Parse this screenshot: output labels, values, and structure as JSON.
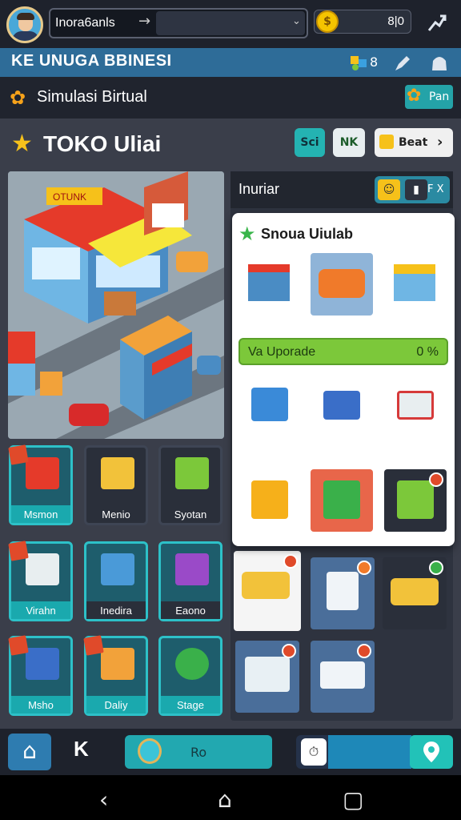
{
  "topbar": {
    "search_label": "Inora6anls",
    "search_arrow": "→",
    "search_chevron": "⌄",
    "coin_symbol": "$",
    "coin_value": "8|0",
    "icon_right": "chart-icon"
  },
  "title_bar": {
    "title": "KE  UNUGA BBINESI",
    "count": "8",
    "icons": [
      "puzzle-icon",
      "pencil-icon",
      "bag-icon"
    ]
  },
  "sim_bar": {
    "label": "Simulasi   Birtual",
    "button_label": "Pan"
  },
  "store": {
    "title": "TOKO Uliai",
    "chip_sc": "Sci",
    "chip_nk": "NK",
    "chip_beat": "Beat",
    "chip_chevron": "›"
  },
  "city": {
    "sign_text": "OTUNK"
  },
  "grid_items": [
    {
      "label": "Msmon"
    },
    {
      "label": "Menio"
    },
    {
      "label": "Syotan"
    },
    {
      "label": "Virahn"
    },
    {
      "label": "Inedira"
    },
    {
      "label": "Eaono"
    },
    {
      "label": "Msho"
    },
    {
      "label": "Daliy"
    },
    {
      "label": "Stage"
    }
  ],
  "inventory": {
    "title": "Inuriar",
    "tool_label": "F X"
  },
  "popup": {
    "title": "Snoua Uiulab",
    "upgrade_label": "Va Uporade",
    "upgrade_value": "0 %"
  },
  "bottom_nav": {
    "logo": "K",
    "bar_label": "Ro",
    "clock_glyph": "⏱",
    "pin_glyph": "⬤"
  },
  "system_nav": {
    "back": "‹",
    "home": "⌂",
    "recent": "▢"
  },
  "colors": {
    "accent_teal": "#2dc1c8",
    "title_blue": "#2e6c98",
    "upgrade_green": "#7cc83a",
    "coin_gold": "#f5c400"
  }
}
